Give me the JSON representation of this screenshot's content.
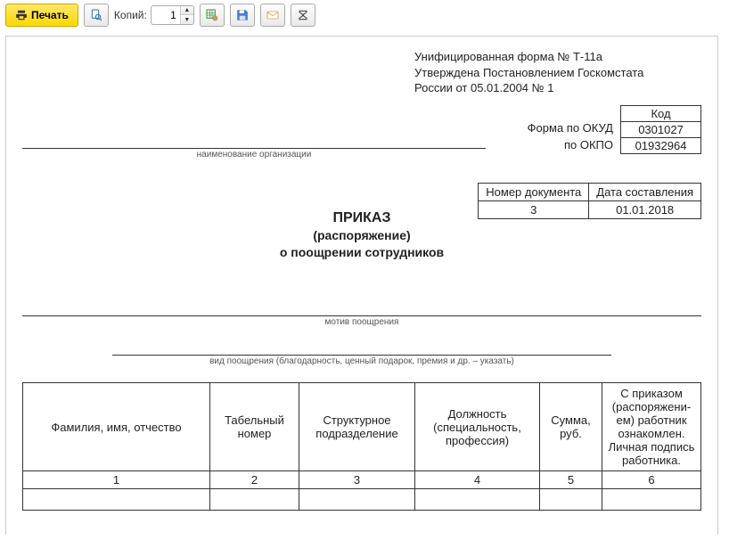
{
  "toolbar": {
    "print_label": "Печать",
    "copies_label": "Копий:",
    "copies_value": "1"
  },
  "form_note": {
    "line1": "Унифицированная форма № Т-11а",
    "line2": "Утверждена Постановлением Госкомстата",
    "line3": "России от 05.01.2004 № 1"
  },
  "codes": {
    "okud_label": "Форма по ОКУД",
    "okpo_label": "по ОКПО",
    "header": "Код",
    "okud_value": "0301027",
    "okpo_value": "01932964"
  },
  "captions": {
    "org": "наименование организации",
    "motive": "мотив поощрения",
    "kind": "вид поощрения (благодарность, ценный подарок, премия и др. – указать)"
  },
  "doc_meta": {
    "num_header": "Номер документа",
    "date_header": "Дата составления",
    "num_value": "3",
    "date_value": "01.01.2018"
  },
  "title": {
    "l1": "ПРИКАЗ",
    "l2": "(распоряжение)",
    "l3": "о поощрении сотрудников"
  },
  "table": {
    "headers": [
      "Фамилия, имя, отчество",
      "Табельный номер",
      "Структурное подразделение",
      "Должность (специальность, профессия)",
      "Сумма, руб.",
      "С приказом (распоряжени-ем) работник ознакомлен. Личная подпись работника."
    ],
    "nums": [
      "1",
      "2",
      "3",
      "4",
      "5",
      "6"
    ]
  }
}
